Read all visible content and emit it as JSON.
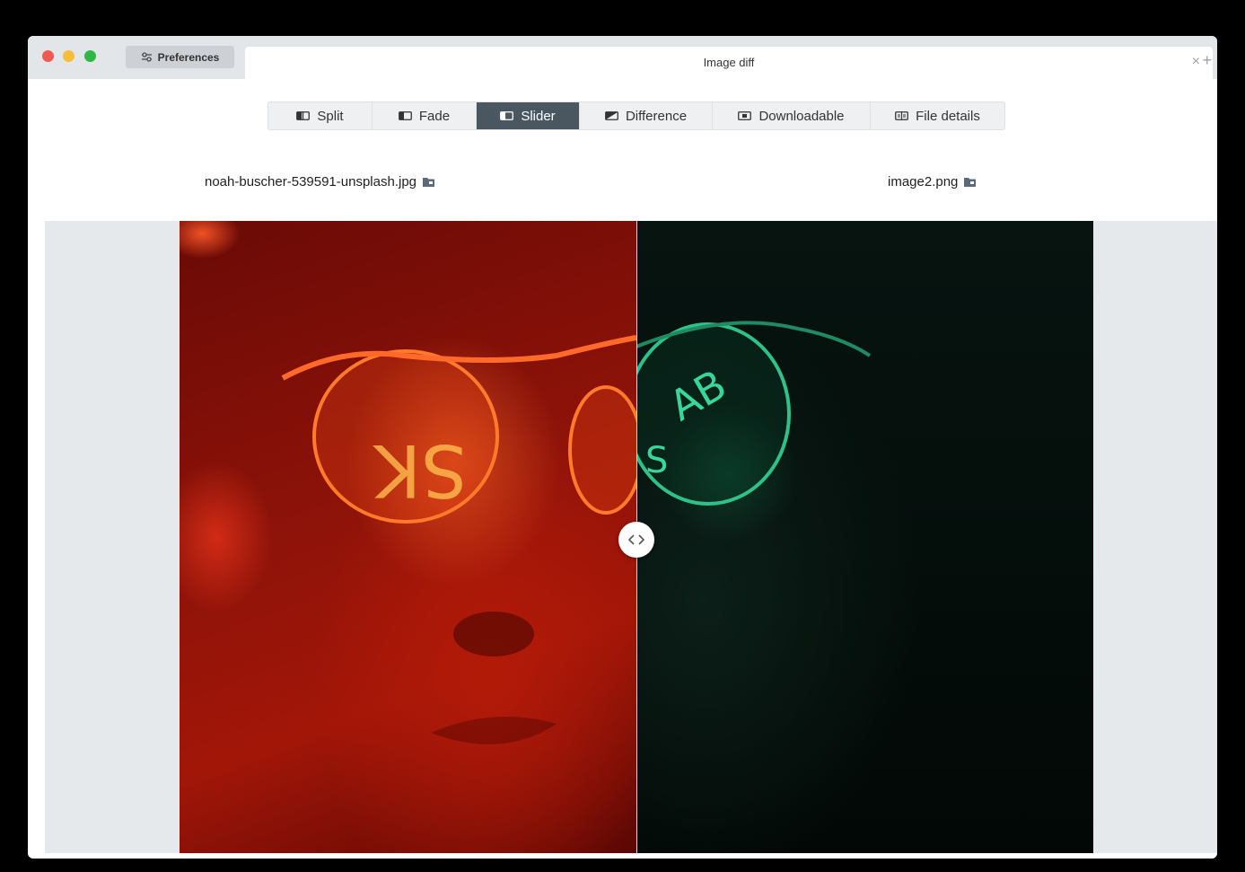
{
  "window": {
    "preferences_label": "Preferences",
    "tab_title": "Image diff",
    "close_glyph": "×",
    "add_glyph": "+"
  },
  "toolbar": {
    "modes": [
      {
        "label": "Split",
        "icon": "split-icon",
        "active": false
      },
      {
        "label": "Fade",
        "icon": "fade-icon",
        "active": false
      },
      {
        "label": "Slider",
        "icon": "slider-icon",
        "active": true
      },
      {
        "label": "Difference",
        "icon": "difference-icon",
        "active": false
      },
      {
        "label": "Downloadable",
        "icon": "download-icon",
        "active": false
      },
      {
        "label": "File details",
        "icon": "file-details-icon",
        "active": false
      }
    ]
  },
  "files": {
    "left": "noah-buscher-539591-unsplash.jpg",
    "right": "image2.png"
  },
  "slider": {
    "position": 0.5
  },
  "colors": {
    "active_button": "#4a5761",
    "left_tint": "#a21608",
    "right_tint": "#0c1f18"
  }
}
